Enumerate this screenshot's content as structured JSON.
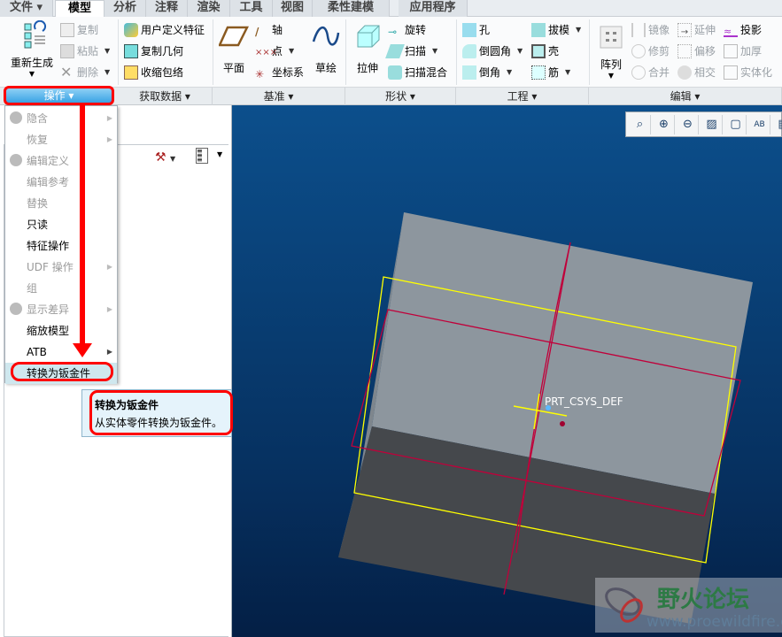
{
  "tabs": [
    {
      "label": "文件 ▾"
    },
    {
      "label": "模型"
    },
    {
      "label": "分析"
    },
    {
      "label": "注释"
    },
    {
      "label": "渲染"
    },
    {
      "label": "工具"
    },
    {
      "label": "视图"
    },
    {
      "label": "柔性建模"
    },
    {
      "label": "应用程序"
    }
  ],
  "ribbon": {
    "operations": {
      "regenerate": "重新生成",
      "copy": "复制",
      "paste": "粘贴",
      "delete": "删除"
    },
    "get_data": {
      "udf": "用户定义特征",
      "copy_geom": "复制几何",
      "shrinkwrap": "收缩包络"
    },
    "datum": {
      "plane": "平面",
      "axis": "轴",
      "point": "点",
      "csys": "坐标系",
      "sketch": "草绘"
    },
    "shape": {
      "extrude": "拉伸",
      "revolve": "旋转",
      "sweep": "扫描",
      "swept_blend": "扫描混合"
    },
    "engineering": {
      "hole": "孔",
      "round": "倒圆角",
      "chamfer": "倒角",
      "draft": "拔模",
      "shell": "壳",
      "rib": "筋"
    },
    "editing": {
      "pattern": "阵列",
      "mirror": "镜像",
      "trim": "修剪",
      "merge": "合并",
      "extend": "延伸",
      "offset": "偏移",
      "intersect": "相交",
      "project": "投影",
      "thicken": "加厚",
      "solidify": "实体化"
    }
  },
  "groups": {
    "operations": "操作 ▾",
    "get_data": "获取数据 ▾",
    "datum": "基准 ▾",
    "shape": "形状 ▾",
    "engineering": "工程 ▾",
    "editing": "编辑 ▾"
  },
  "menu": {
    "items": [
      {
        "label": "隐含",
        "enabled": false,
        "submenu": true
      },
      {
        "label": "恢复",
        "enabled": false,
        "submenu": true
      },
      {
        "label": "编辑定义",
        "enabled": false
      },
      {
        "label": "编辑参考",
        "enabled": false
      },
      {
        "label": "替换",
        "enabled": false
      },
      {
        "label": "只读",
        "enabled": true
      },
      {
        "label": "特征操作",
        "enabled": true
      },
      {
        "label": "UDF 操作",
        "enabled": false,
        "submenu": true
      },
      {
        "label": "组",
        "enabled": false
      },
      {
        "label": "显示差异",
        "enabled": false,
        "submenu": true
      },
      {
        "label": "缩放模型",
        "enabled": true
      },
      {
        "label": "ATB",
        "enabled": true,
        "submenu": true
      },
      {
        "label": "转换为钣金件",
        "enabled": true,
        "highlighted": true
      }
    ]
  },
  "tooltip": {
    "title": "转换为钣金件",
    "description": "从实体零件转换为钣金件。"
  },
  "viewport": {
    "csys_label": "PRT_CSYS_DEF"
  },
  "watermark": {
    "name": "野火论坛",
    "url": "www.proewildfire.cn"
  },
  "colors": {
    "annotation": "#ff0000",
    "datum_plane_yellow": "#ffff00",
    "datum_red": "#c0003a",
    "viewport_bg": "#0c4f8c"
  }
}
